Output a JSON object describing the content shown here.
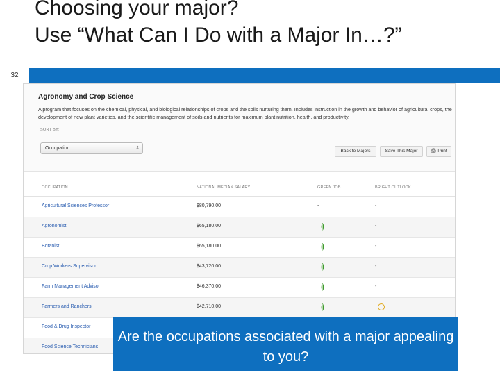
{
  "slide": {
    "title": "Choosing your major?\nUse “What Can I Do with a Major In…?”",
    "number": "32",
    "callout": "Are the  occupations associated with a major appealing to you?"
  },
  "major": {
    "title": "Agronomy and Crop Science",
    "description": "A program that focuses on the chemical, physical, and biological relationships of crops and the soils nurturing them. Includes instruction in the growth and behavior of agricultural crops, the development of new plant varieties, and the scientific management of soils and nutrients for maximum plant nutrition, health, and productivity.",
    "sort_label": "SORT BY:",
    "sort_value": "Occupation",
    "buttons": {
      "back": "Back to Majors",
      "save": "Save This Major",
      "print": "🖨 Print"
    }
  },
  "table": {
    "headers": [
      "OCCUPATION",
      "NATIONAL MEDIAN SALARY",
      "GREEN JOB",
      "BRIGHT OUTLOOK"
    ],
    "rows": [
      {
        "occupation": "Agricultural Sciences Professor",
        "salary": "$80,790.00",
        "green": "-",
        "bright": "-"
      },
      {
        "occupation": "Agronomist",
        "salary": "$65,180.00",
        "green": "leaf-icon",
        "bright": "-"
      },
      {
        "occupation": "Botanist",
        "salary": "$65,180.00",
        "green": "leaf-icon",
        "bright": "-"
      },
      {
        "occupation": "Crop Workers Supervisor",
        "salary": "$43,720.00",
        "green": "leaf-icon",
        "bright": "-"
      },
      {
        "occupation": "Farm Management Advisor",
        "salary": "$46,370.00",
        "green": "leaf-icon",
        "bright": "-"
      },
      {
        "occupation": "Farmers and Ranchers",
        "salary": "$42,710.00",
        "green": "leaf-icon",
        "bright": "sun-icon"
      },
      {
        "occupation": "Food & Drug Inspector",
        "salary": "",
        "green": "",
        "bright": ""
      },
      {
        "occupation": "Food Science Technicians",
        "salary": "",
        "green": "",
        "bright": ""
      }
    ]
  },
  "colors": {
    "accent": "#0e6fbf",
    "link": "#2a5db0",
    "green_icon": "#3f9b2e",
    "bright_icon": "#e0a81a"
  }
}
